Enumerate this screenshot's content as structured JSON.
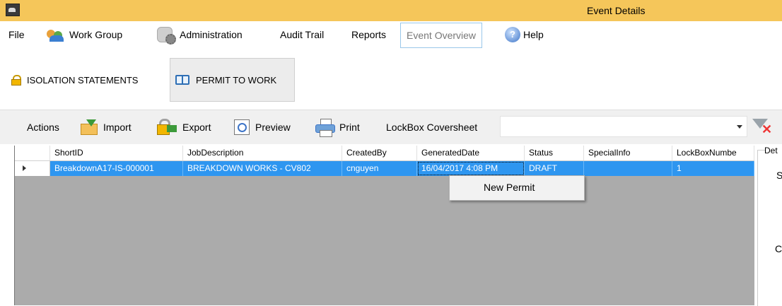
{
  "window": {
    "title": "Event Details",
    "app_icon": "car-icon"
  },
  "menu": {
    "file": "File",
    "work_group": "Work Group",
    "administration": "Administration",
    "audit_trail": "Audit Trail",
    "reports": "Reports",
    "event_overview": "Event Overview",
    "help": "Help"
  },
  "tabs": {
    "isolation": "ISOLATION STATEMENTS",
    "permit": "PERMIT TO WORK"
  },
  "actions": {
    "actions": "Actions",
    "import": "Import",
    "export": "Export",
    "preview": "Preview",
    "print": "Print",
    "lockbox_label": "LockBox Coversheet",
    "lockbox_value": ""
  },
  "grid": {
    "columns": [
      "ShortID",
      "JobDescription",
      "CreatedBy",
      "GeneratedDate",
      "Status",
      "SpecialInfo",
      "LockBoxNumbe"
    ],
    "rows": [
      {
        "short_id": "BreakdownA17-IS-000001",
        "job": "BREAKDOWN WORKS - CV802",
        "created_by": "cnguyen",
        "date": "16/04/2017 4:08 PM",
        "status": "DRAFT",
        "special": "",
        "lockbox": "1"
      }
    ]
  },
  "context_menu": {
    "new_permit": "New Permit"
  },
  "details": {
    "label": "Det",
    "s": "S",
    "c": "C"
  },
  "colors": {
    "titlebar": "#f5c65a",
    "selection": "#2e96f0",
    "grid_bg": "#ababab"
  }
}
